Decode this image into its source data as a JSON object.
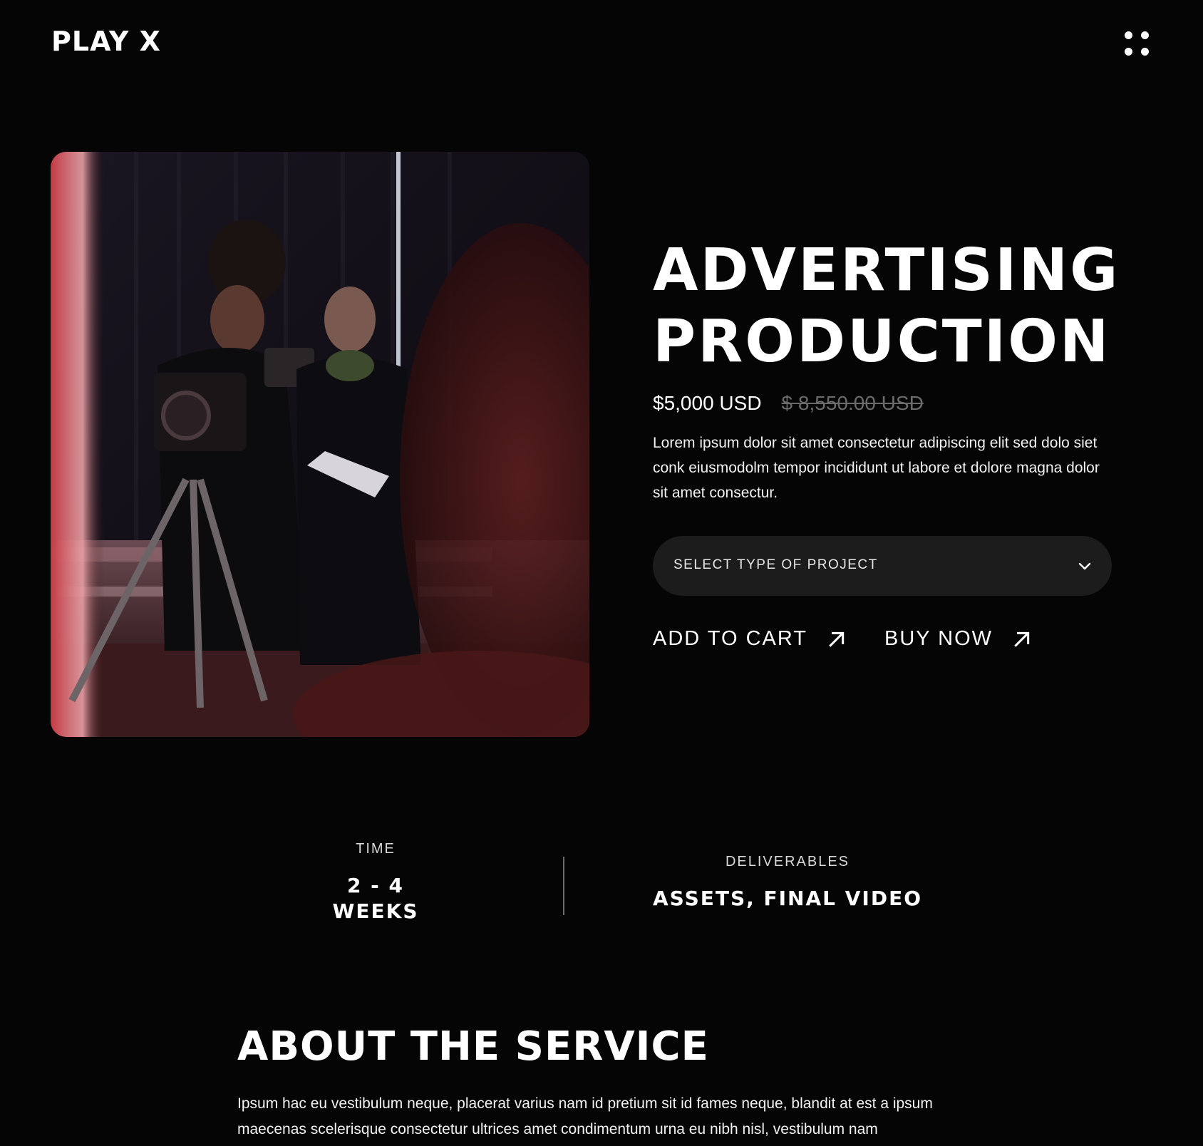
{
  "header": {
    "logo": "PLAY X",
    "menu_icon": "grid-dots-icon"
  },
  "product": {
    "title_line1": "ADVERTISING",
    "title_line2": "PRODUCTION",
    "price": "$5,000 USD",
    "old_price": "$ 8,550.00 USD",
    "description": "Lorem ipsum dolor sit amet consectetur adipiscing elit sed dolo siet conk eiusmodolm tempor incididunt ut labore et dolore magna dolor sit amet consectur.",
    "select": {
      "placeholder": "SELECT TYPE OF PROJECT",
      "icon": "chevron-down-icon"
    },
    "add_to_cart": "ADD TO CART",
    "buy_now": "BUY NOW",
    "action_icon": "arrow-up-right-icon"
  },
  "stats": {
    "time_label": "TIME",
    "time_value_line1": "2 - 4",
    "time_value_line2": "WEEKS",
    "deliverables_label": "DELIVERABLES",
    "deliverables_value": "ASSETS, FINAL VIDEO"
  },
  "about": {
    "title": "ABOUT THE SERVICE",
    "text": "Ipsum hac eu vestibulum neque, placerat varius nam id pretium sit id fames neque, blandit at est a ipsum maecenas scelerisque consectetur ultrices amet condimentum urna eu nibh nisl, vestibulum nam"
  },
  "colors": {
    "background": "#050505",
    "text": "#ffffff",
    "muted": "#6b6b6b",
    "select_bg": "#1c1c1c"
  }
}
